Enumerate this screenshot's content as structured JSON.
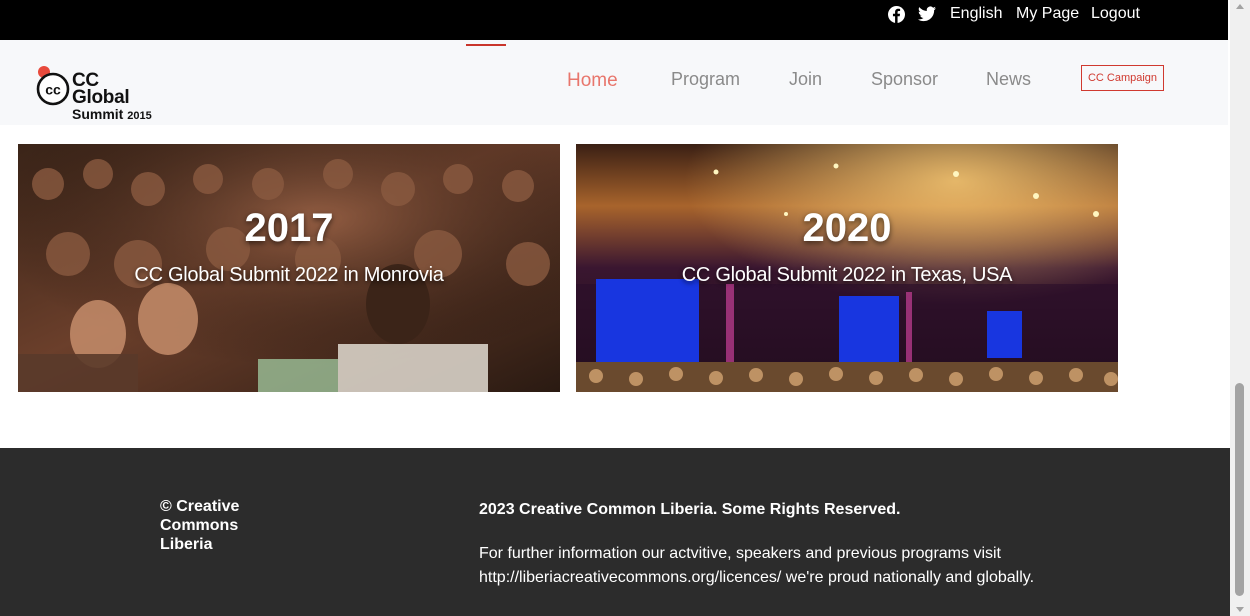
{
  "topbar": {
    "icons": [
      "facebook-icon",
      "twitter-icon"
    ],
    "links": [
      "English",
      "My Page",
      "Logout"
    ]
  },
  "logo": {
    "line1": "CC Global",
    "line2": "Summit",
    "year": "2015"
  },
  "nav": {
    "items": [
      "Home",
      "Program",
      "Join",
      "Sponsor",
      "News"
    ],
    "active": "Home",
    "campaign": "CC Campaign"
  },
  "cards": [
    {
      "year": "2017",
      "subtitle": "CC Global Submit 2022 in Monrovia"
    },
    {
      "year": "2020",
      "subtitle": "CC Global Submit 2022 in Texas, USA"
    }
  ],
  "footer": {
    "brand": "© Creative Commons Liberia",
    "rights": "2023 Creative Common Liberia. Some Rights Reserved.",
    "info": "For further information our actvitive, speakers and previous programs visit http://liberiacreativecommons.org/licences/ we're proud nationally and globally."
  },
  "colors": {
    "topbar": "#000000",
    "header": "#f7f8fa",
    "accent": "#e8766c",
    "campaign": "#d0392f",
    "footer": "#2c2c2c"
  }
}
